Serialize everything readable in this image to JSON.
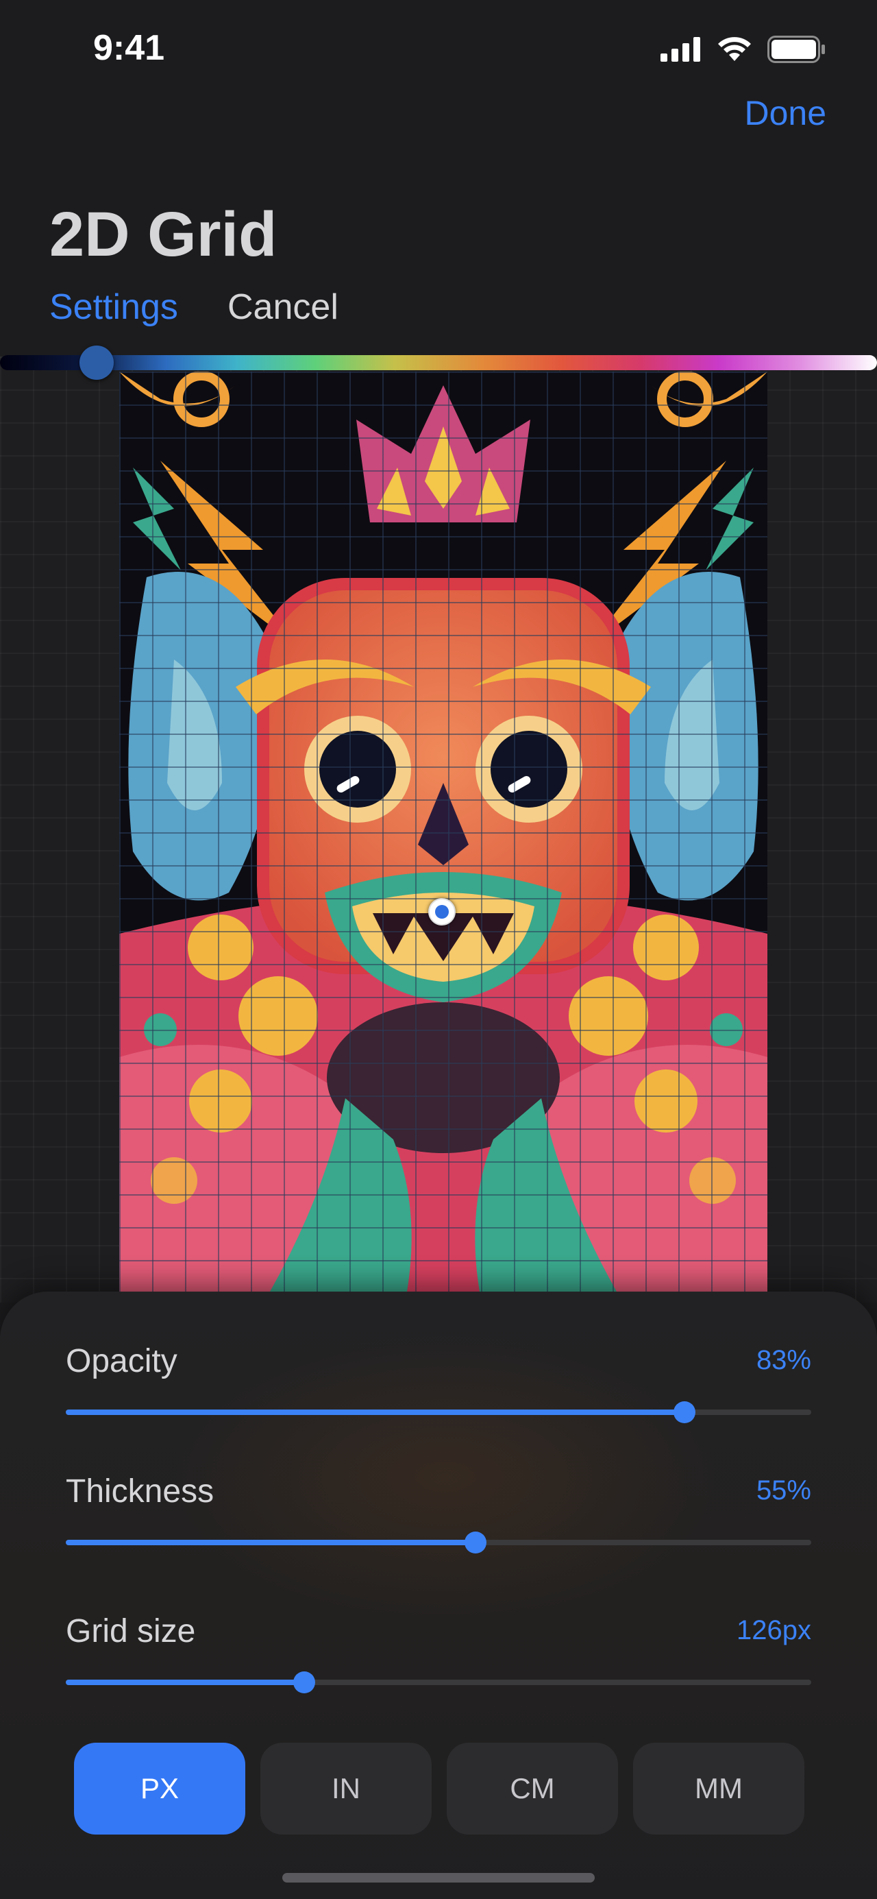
{
  "status": {
    "time": "9:41"
  },
  "header": {
    "done": "Done",
    "title": "2D Grid"
  },
  "tabs": {
    "settings": "Settings",
    "cancel": "Cancel"
  },
  "colors": {
    "accent": "#3b82f6",
    "panel": "#232325",
    "background": "#1c1c1e"
  },
  "hue_slider": {
    "value": 0.11
  },
  "controls": {
    "opacity": {
      "label": "Opacity",
      "value": "83%",
      "fraction": 0.83
    },
    "thickness": {
      "label": "Thickness",
      "value": "55%",
      "fraction": 0.55
    },
    "grid_size": {
      "label": "Grid size",
      "value": "126px",
      "fraction": 0.32
    }
  },
  "units": [
    {
      "label": "PX",
      "active": true
    },
    {
      "label": "IN",
      "active": false
    },
    {
      "label": "CM",
      "active": false
    },
    {
      "label": "MM",
      "active": false
    }
  ],
  "icons": [
    "signal-icon",
    "wifi-icon",
    "battery-icon"
  ]
}
